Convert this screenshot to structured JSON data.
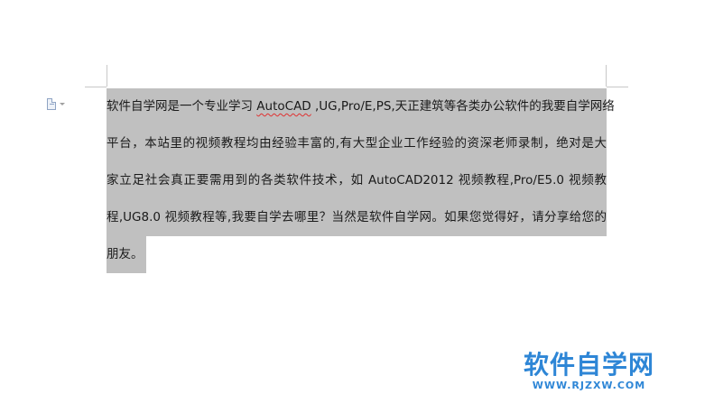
{
  "document": {
    "lines": [
      {
        "pre": "软件自学网是一个专业学习 ",
        "flag": "AutoCAD",
        "post": " ,UG,Pro/E,PS,天正建筑等各类办公软件的我要自学网络"
      },
      {
        "text": "平台，本站里的视频教程均由经验丰富的,有大型企业工作经验的资深老师录制，绝对是大"
      },
      {
        "text": "家立足社会真正要需用到的各类软件技术，如 AutoCAD2012 视频教程,Pro/E5.0 视频教"
      },
      {
        "text": "程,UG8.0 视频教程等,我要自学去哪里？当然是软件自学网。如果您觉得好，请分享给您的"
      },
      {
        "text": "朋友。"
      }
    ]
  },
  "icons": {
    "paragraph_marker": "document-icon",
    "marker_dropdown": "caret-down-icon"
  },
  "watermark": {
    "title": "软件自学网",
    "url": "WWW.RJZXW.COM"
  },
  "colors": {
    "selection": "#c0c0c0",
    "spellcheck": "#e03030",
    "watermark": "#2e86d6"
  }
}
